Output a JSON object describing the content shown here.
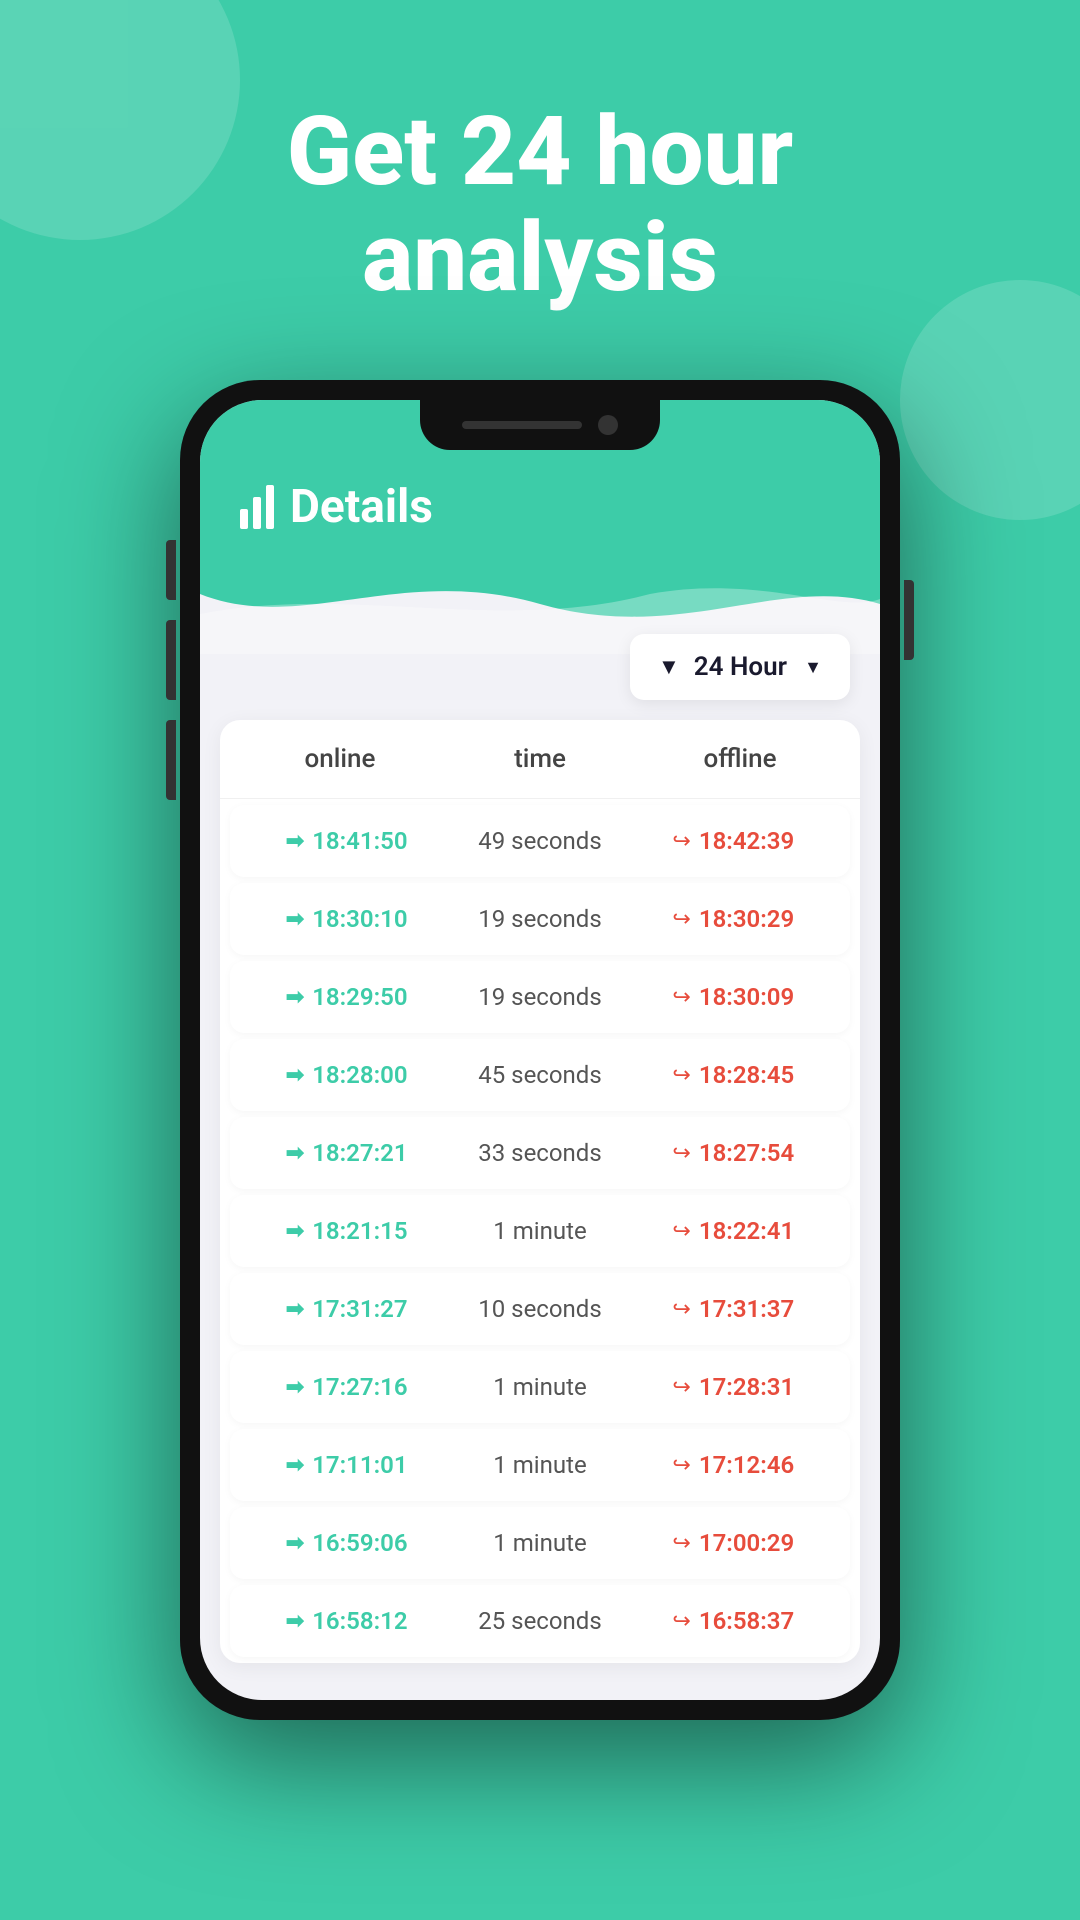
{
  "background": {
    "color": "#3dcca8"
  },
  "header": {
    "title_line1": "Get 24 hour",
    "title_line2": "analysis"
  },
  "phone": {
    "screen_title": "Details",
    "filter": {
      "label": "24 Hour",
      "icon": "▼"
    },
    "table": {
      "columns": [
        "online",
        "time",
        "offline"
      ],
      "rows": [
        {
          "online": "18:41:50",
          "duration": "49 seconds",
          "offline": "18:42:39"
        },
        {
          "online": "18:30:10",
          "duration": "19 seconds",
          "offline": "18:30:29"
        },
        {
          "online": "18:29:50",
          "duration": "19 seconds",
          "offline": "18:30:09"
        },
        {
          "online": "18:28:00",
          "duration": "45 seconds",
          "offline": "18:28:45"
        },
        {
          "online": "18:27:21",
          "duration": "33 seconds",
          "offline": "18:27:54"
        },
        {
          "online": "18:21:15",
          "duration": "1 minute",
          "offline": "18:22:41"
        },
        {
          "online": "17:31:27",
          "duration": "10 seconds",
          "offline": "17:31:37"
        },
        {
          "online": "17:27:16",
          "duration": "1 minute",
          "offline": "17:28:31"
        },
        {
          "online": "17:11:01",
          "duration": "1 minute",
          "offline": "17:12:46"
        },
        {
          "online": "16:59:06",
          "duration": "1 minute",
          "offline": "17:00:29"
        },
        {
          "online": "16:58:12",
          "duration": "25 seconds",
          "offline": "16:58:37"
        }
      ]
    }
  }
}
